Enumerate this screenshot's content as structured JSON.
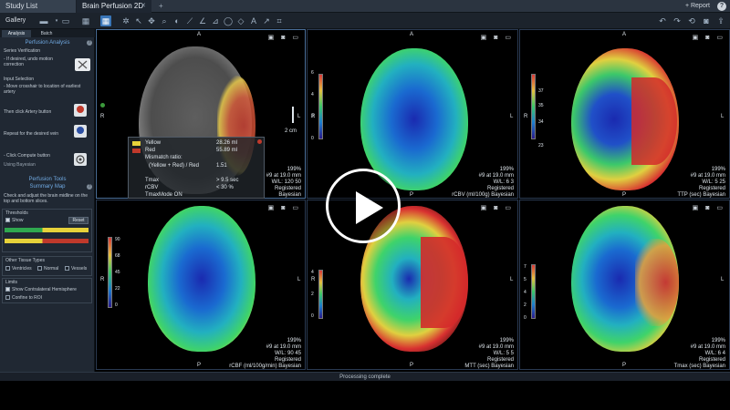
{
  "tabs": {
    "study_list": "Study List",
    "active": "Brain Perfusion 2D",
    "close": "✕",
    "plus": "+"
  },
  "header": {
    "report": "+ Report",
    "help": "?"
  },
  "toolbar": {
    "gallery": "Gallery"
  },
  "sidebar": {
    "tabs": [
      "Analysis",
      "Batch"
    ],
    "perfusion_analysis": "Perfusion Analysis",
    "series_verification": "Series Verification",
    "motion_note": "- If desired, undo motion correction",
    "input_selection": "Input Selection",
    "crosshair_note": "- Move crosshair to location of earliest artery",
    "artery_note": "Then click Artery button",
    "artery_btn": "Artery",
    "vein_note": "Repeat for the desired vein",
    "vein_btn": "Vein",
    "compute_note": "- Click Compute button",
    "compute_sub": "Using Bayesian",
    "compute_btn": "Compute",
    "perfusion_tools": "Perfusion Tools",
    "summary_map": "Summary Map",
    "midline_note": "Check and adjust the brain midline on the top and bottom slices.",
    "thresholds": "Thresholds",
    "show": "Show",
    "reset": "Reset",
    "other_tissue": "Other Tissue Types",
    "ventricles": "Ventricles",
    "normal": "Normal",
    "vessels": "Vessels",
    "limits": "Limits",
    "contralateral": "Show Contralateral Hemisphere",
    "confine": "Confine to ROI"
  },
  "mismatch": {
    "yellow_label": "Yellow",
    "yellow_val": "28.26 ml",
    "red_label": "Red",
    "red_val": "55.89 ml",
    "ratio_label": "Mismatch ratio:",
    "ratio_formula": "(Yellow + Red) / Red",
    "ratio_val": "1.51",
    "tmax_label": "Tmax",
    "tmax_val": "> 9.5 sec",
    "rcbv_label": "rCBV",
    "rcbv_val": "< 30 %",
    "tmaxmode": "TmaxMode ON"
  },
  "viewports": [
    {
      "name": "summary",
      "zoom": "199%",
      "slice": "#9 at 19.0 mm",
      "wl": "W/L: 120 50",
      "status": "Registered",
      "method": "Bayesian",
      "scale": "2 cm",
      "map": ""
    },
    {
      "name": "rcbv",
      "zoom": "199%",
      "slice": "#9 at 19.0 mm",
      "wl": "W/L: 6 3",
      "status": "Registered",
      "method": "Bayesian",
      "map": "rCBV (ml/100g) Bayesian",
      "ticks": [
        "6",
        "4",
        "2",
        "0"
      ]
    },
    {
      "name": "ttp",
      "zoom": "199%",
      "slice": "#9 at 19.0 mm",
      "wl": "W/L: 5 25",
      "status": "Registered",
      "method": "Bayesian",
      "map": "TTP (sec) Bayesian",
      "ticks": [
        "37",
        "35",
        "34",
        "23"
      ]
    },
    {
      "name": "rcbf",
      "zoom": "199%",
      "slice": "#9 at 19.0 mm",
      "wl": "W/L: 90 45",
      "status": "Registered",
      "method": "Bayesian",
      "map": "rCBF (ml/100g/min) Bayesian",
      "ticks": [
        "90",
        "68",
        "45",
        "22",
        "0"
      ]
    },
    {
      "name": "mtt",
      "zoom": "199%",
      "slice": "#9 at 19.0 mm",
      "wl": "W/L: 5 5",
      "status": "Registered",
      "method": "Bayesian",
      "map": "MTT (sec) Bayesian",
      "ticks": [
        "4",
        "2",
        "0"
      ]
    },
    {
      "name": "tmax",
      "zoom": "199%",
      "slice": "#9 at 19.0 mm",
      "wl": "W/L: 6 4",
      "status": "Registered",
      "method": "Bayesian",
      "map": "Tmax (sec) Bayesian",
      "ticks": [
        "7",
        "5",
        "4",
        "2",
        "0"
      ]
    }
  ],
  "orient": {
    "a": "A",
    "p": "P",
    "l": "L",
    "r": "R"
  },
  "status": "Processing complete"
}
